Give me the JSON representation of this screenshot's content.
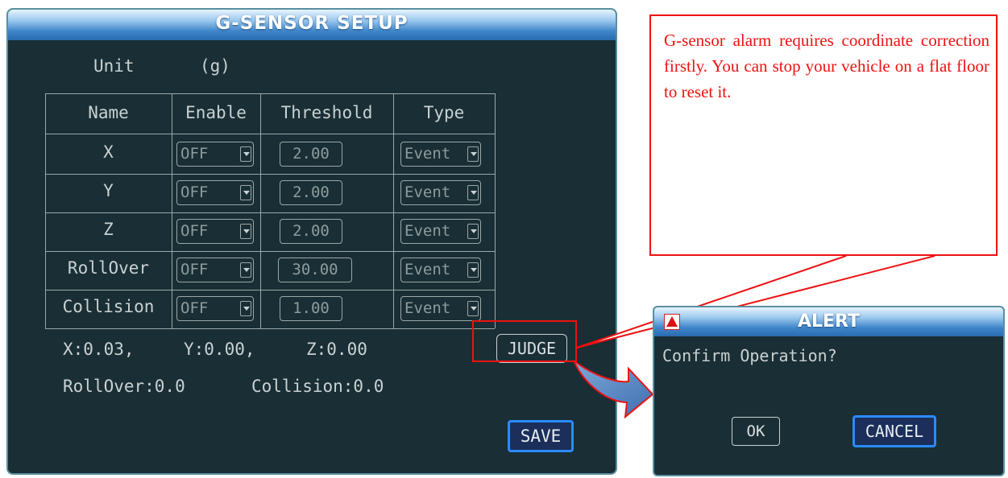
{
  "panel": {
    "title": "G-SENSOR SETUP",
    "unit_label": "Unit",
    "unit_value": "(g)",
    "table": {
      "headers": [
        "Name",
        "Enable",
        "Threshold",
        "Type"
      ],
      "rows": [
        {
          "name": "X",
          "enable": "OFF",
          "threshold": "2.00",
          "type": "Event"
        },
        {
          "name": "Y",
          "enable": "OFF",
          "threshold": "2.00",
          "type": "Event"
        },
        {
          "name": "Z",
          "enable": "OFF",
          "threshold": "2.00",
          "type": "Event"
        },
        {
          "name": "RollOver",
          "enable": "OFF",
          "threshold": "30.00",
          "type": "Event"
        },
        {
          "name": "Collision",
          "enable": "OFF",
          "threshold": "1.00",
          "type": "Event"
        }
      ]
    },
    "readouts": {
      "x": "X:0.03,",
      "y": "Y:0.00,",
      "z": "Z:0.00",
      "rollover": "RollOver:0.0",
      "collision": "Collision:0.0"
    },
    "judge_label": "JUDGE",
    "save_label": "SAVE"
  },
  "callout": {
    "text": "G-sensor alarm requires coordinate correction firstly. You can stop your vehicle on a flat floor to reset it."
  },
  "alert": {
    "title": "ALERT",
    "message": "Confirm Operation?",
    "ok_label": "OK",
    "cancel_label": "CANCEL"
  },
  "colors": {
    "panel_bg": "#1a2e35",
    "text": "#c9d2d2",
    "annotation_red": "#ee1111",
    "save_border": "#2a8bff"
  },
  "icons": [
    "dropdown-arrow-icon",
    "warning-icon"
  ]
}
